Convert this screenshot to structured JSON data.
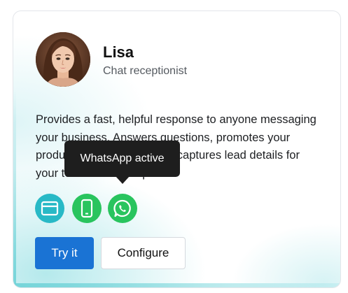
{
  "agent": {
    "name": "Lisa",
    "role": "Chat receptionist",
    "description": "Provides a fast, helpful response to anyone messaging your business. Answers questions, promotes your products and services, and captures lead details for your team to follow up.",
    "avatar_icon": "woman-portrait"
  },
  "channels": [
    {
      "name": "web-chat",
      "icon": "browser-window-icon",
      "color": "#28b9c6"
    },
    {
      "name": "sms",
      "icon": "mobile-phone-icon",
      "color": "#29c45e"
    },
    {
      "name": "whatsapp",
      "icon": "whatsapp-icon",
      "color": "#29c45e"
    }
  ],
  "tooltip": {
    "text": "WhatsApp active"
  },
  "actions": {
    "try_label": "Try it",
    "configure_label": "Configure"
  },
  "colors": {
    "primary_button": "#1a73d4",
    "tooltip_bg": "#1e1e1e",
    "glow": "#78d7dc"
  }
}
